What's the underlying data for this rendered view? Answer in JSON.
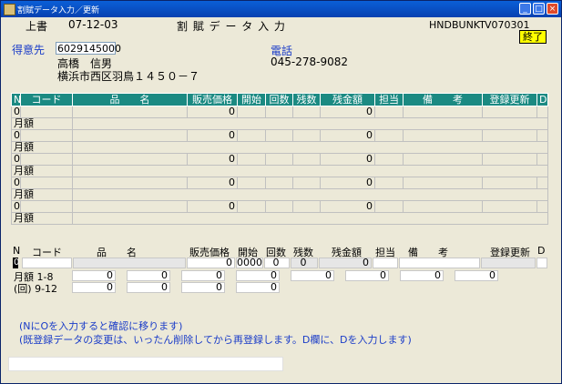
{
  "window": {
    "title": "割賦データ入力／更新",
    "controls": {
      "minimize": "_",
      "maximize": "□",
      "close": "×"
    }
  },
  "header": {
    "mode": "上書",
    "date": "07-12-03",
    "screen_title": "割 賦 デ ー タ 入 力",
    "program_id": "HNDBUNKT",
    "version": "V070301",
    "end_button": "終了"
  },
  "customer": {
    "label": "得意先",
    "code": "6029145000",
    "name": "高橋　信男",
    "address": "横浜市西区羽鳥１４５０－７",
    "phone_label": "電話",
    "phone": "045-278-9082"
  },
  "list_table": {
    "headers": [
      "N",
      "コード",
      "品　　名",
      "販売価格",
      "開始",
      "回数",
      "残数",
      "残金額",
      "担当",
      "備　　考",
      "登録更新",
      "D"
    ],
    "rows": [
      {
        "n": "0",
        "price": "0",
        "balance": "0",
        "sub_label": "月額"
      },
      {
        "n": "0",
        "price": "0",
        "balance": "0",
        "sub_label": "月額"
      },
      {
        "n": "0",
        "price": "0",
        "balance": "0",
        "sub_label": "月額"
      },
      {
        "n": "0",
        "price": "0",
        "balance": "0",
        "sub_label": "月額"
      },
      {
        "n": "0",
        "price": "0",
        "balance": "0",
        "sub_label": "月額"
      }
    ]
  },
  "entry": {
    "headers": [
      "N",
      "コード",
      "品　　名",
      "販売価格",
      "開始",
      "回数",
      "残数",
      "残金額",
      "担当",
      "備　　考",
      "登録更新",
      "D"
    ],
    "n_value": "0",
    "price": "0",
    "start": "0000",
    "count": "0",
    "remaining": "0",
    "balance": "0",
    "monthly_label_1": "月額 1-8",
    "monthly_label_2": "(回) 9-12",
    "monthly_1": [
      "0",
      "0",
      "0",
      "0",
      "0",
      "0",
      "0",
      "0"
    ],
    "monthly_2": [
      "0",
      "0",
      "0",
      "0"
    ]
  },
  "notes": [
    "(NにOを入力すると確認に移ります)",
    "(既登録データの変更は、いったん削除してから再登録します。D欄に、Dを入力します)"
  ]
}
